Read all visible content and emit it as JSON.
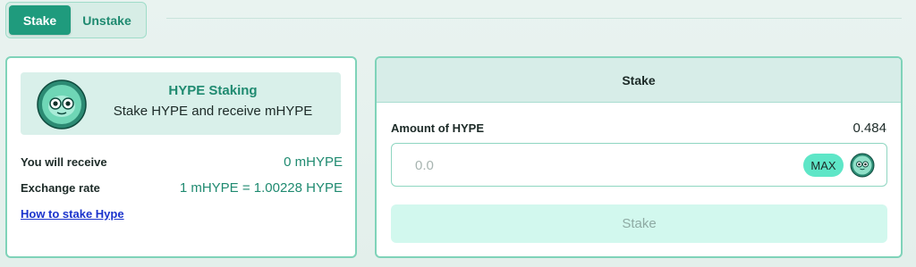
{
  "tabs": [
    {
      "label": "Stake",
      "active": true
    },
    {
      "label": "Unstake",
      "active": false
    }
  ],
  "info": {
    "banner_title": "HYPE Staking",
    "banner_subtitle": "Stake HYPE and receive mHYPE",
    "receive_label": "You will receive",
    "receive_value": "0 mHYPE",
    "rate_label": "Exchange rate",
    "rate_value": "1 mHYPE = 1.00228 HYPE",
    "howto_link": "How to stake Hype",
    "logo_icon": "hype-mascot-icon"
  },
  "stake_panel": {
    "header": "Stake",
    "amount_label": "Amount of HYPE",
    "balance": "0.484",
    "input_placeholder": "0.0",
    "input_value": "",
    "max_label": "MAX",
    "token_icon": "hype-token-icon",
    "submit_label": "Stake"
  },
  "colors": {
    "accent": "#1f9b7d",
    "accent_text": "#1f8a70",
    "border": "#7fd3b9",
    "max_bg": "#5ee6c7",
    "link": "#1a33cc"
  }
}
